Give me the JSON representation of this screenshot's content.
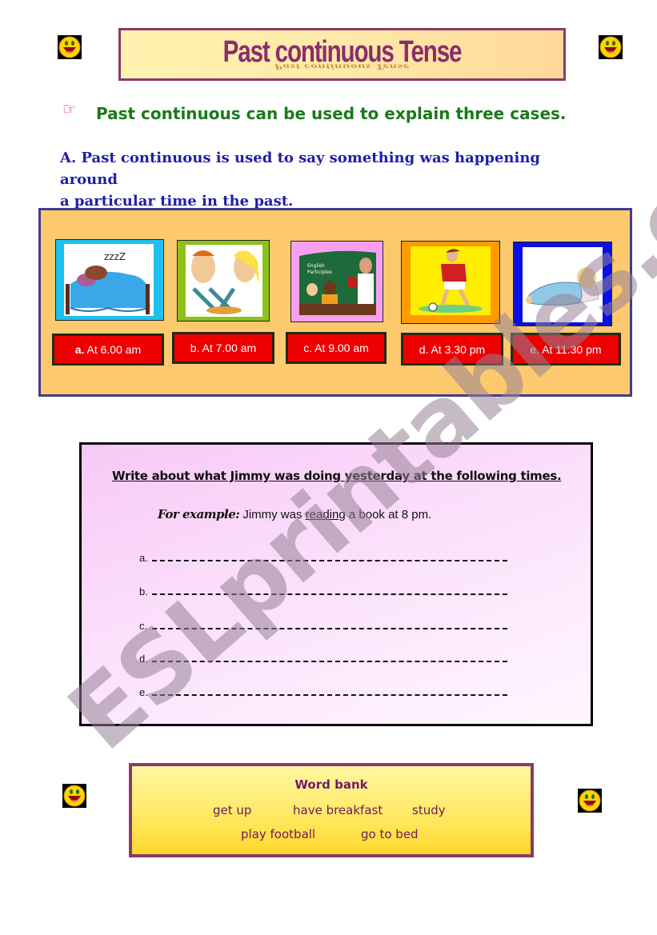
{
  "title": {
    "main": "Past continuous Tense",
    "shadow": "Past continuous Tense"
  },
  "heading": {
    "pointer_icon": "pointing-hand-icon",
    "text": "Past continuous can be used to explain three cases."
  },
  "rule_a": {
    "line1": "A. Past continuous is used to say something was happening around",
    "line2": "a particular time in the past."
  },
  "pictures": [
    {
      "name": "sleeping-in-bed-picture",
      "frame_color": "#1ec0f0",
      "letter": "a.",
      "time": "At 6.00  am",
      "letter_bold": true
    },
    {
      "name": "eating-breakfast-picture",
      "frame_color": "#8cc21a",
      "letter": "b.",
      "time": "At 7.00  am",
      "letter_bold": false
    },
    {
      "name": "classroom-study-picture",
      "frame_color": "#f7a0f0",
      "letter": "c.",
      "time": "At 9.00 am",
      "letter_bold": false
    },
    {
      "name": "playing-football-picture",
      "frame_color": "#ff9a00",
      "letter": "d.",
      "time": "At 3.30 pm",
      "letter_bold": false
    },
    {
      "name": "going-to-bed-picture",
      "frame_color": "#0a10e0",
      "letter": "e.",
      "time": "At 11.30 pm",
      "letter_bold": false
    }
  ],
  "watermark": "ESLprintables.com",
  "exercise": {
    "instruction": "Write about what Jimmy was doing yesterday at the following times.",
    "example_label": "For example:",
    "example_before": "Jimmy was ",
    "example_underlined": "reading",
    "example_after": " a book at 8 pm.",
    "answers": [
      {
        "label": "a.",
        "value": ""
      },
      {
        "label": "b.",
        "value": ""
      },
      {
        "label": "c.",
        "value": ""
      },
      {
        "label": "d.",
        "value": ""
      },
      {
        "label": "e.",
        "value": ""
      }
    ]
  },
  "word_bank": {
    "title": "Word  bank",
    "words": [
      "get up",
      "have breakfast",
      "study",
      "play football",
      "go to bed"
    ]
  },
  "colors": {
    "title_border": "#8a3a6a",
    "title_text": "#8b2d6b",
    "heading_green": "#1a7a1a",
    "rule_blue": "#1f1fa8",
    "panel_bg": "#fcc96e",
    "panel_border": "#433c8e",
    "time_button_red": "#ec0000",
    "word_bank_text": "#6e1a5a"
  }
}
